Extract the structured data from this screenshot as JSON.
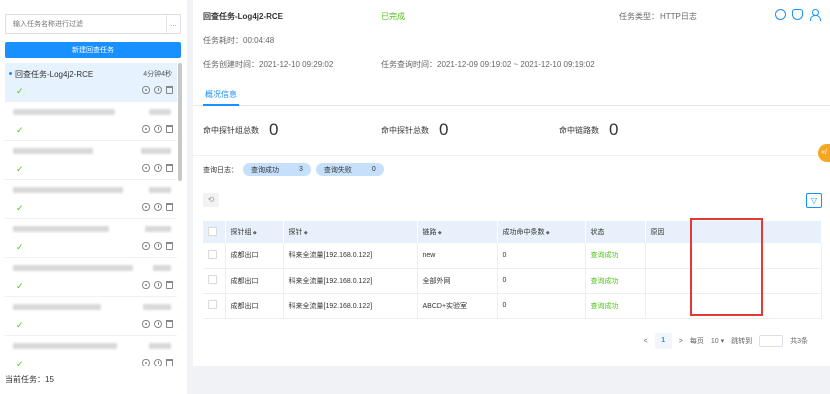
{
  "sidebar": {
    "search_placeholder": "输入任务名称进行过滤",
    "more_label": "...",
    "new_task_button": "新建回查任务",
    "tasks": [
      {
        "name": "回查任务-Log4j2-RCE",
        "duration": "4分钟4秒"
      },
      {
        "name": "",
        "duration": ""
      },
      {
        "name": "",
        "duration": ""
      },
      {
        "name": "",
        "duration": ""
      },
      {
        "name": "",
        "duration": ""
      },
      {
        "name": "",
        "duration": ""
      },
      {
        "name": "",
        "duration": ""
      },
      {
        "name": "",
        "duration": ""
      }
    ],
    "current_tasks": "当前任务：15"
  },
  "header": {
    "title": "回查任务-Log4j2-RCE",
    "status": "已完成",
    "task_type_label": "任务类型：",
    "task_type_value": "HTTP日志",
    "elapsed_label": "任务耗时：",
    "elapsed_value": "00:04:48",
    "created_label": "任务创建时间：",
    "created_value": "2021-12-10 09:29:02",
    "query_label": "任务查询时间：",
    "query_value": "2021-12-09 09:19:02 ~ 2021-12-10 09:19:02"
  },
  "tabs": [
    {
      "label": "概况信息"
    }
  ],
  "stats": [
    {
      "label": "命中探针组总数",
      "value": "0"
    },
    {
      "label": "命中探针总数",
      "value": "0"
    },
    {
      "label": "命中链路数",
      "value": "0"
    }
  ],
  "query_log": {
    "label": "查询日志：",
    "success_label": "查询成功",
    "success_count": "3",
    "fail_label": "查询失败",
    "fail_count": "0"
  },
  "table": {
    "columns": [
      "探针组",
      "探针",
      "链路",
      "成功命中条数",
      "状态",
      "原因"
    ],
    "rows": [
      {
        "group": "成都出口",
        "probe": "科来全流量[192.168.0.122]",
        "link": "new",
        "hits": "0",
        "status": "查询成功",
        "reason": ""
      },
      {
        "group": "成都出口",
        "probe": "科来全流量[192.168.0.122]",
        "link": "全部外网",
        "hits": "0",
        "status": "查询成功",
        "reason": ""
      },
      {
        "group": "成都出口",
        "probe": "科来全流量[192.168.0.122]",
        "link": "ABCD+实验室",
        "hits": "0",
        "status": "查询成功",
        "reason": ""
      }
    ]
  },
  "pagination": {
    "prev": "<",
    "page": "1",
    "next": ">",
    "per_page_label": "每页",
    "per_page_value": "10 ▾",
    "jump_label": "跳转到",
    "total": "共3条"
  },
  "side_tab_label": "«/"
}
